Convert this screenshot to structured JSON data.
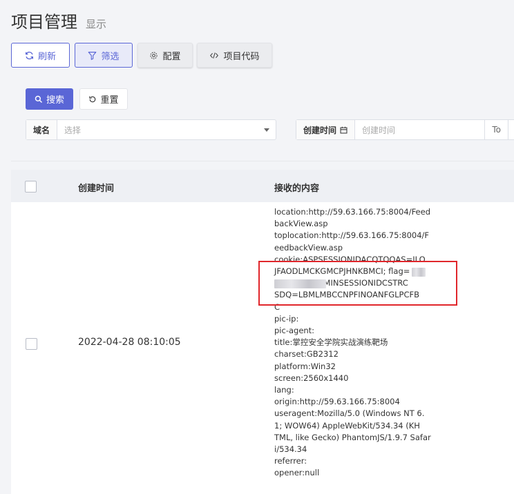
{
  "header": {
    "title": "项目管理",
    "subtitle": "显示"
  },
  "toolbar": {
    "refresh_label": "刷新",
    "filter_label": "筛选",
    "config_label": "配置",
    "code_label": "项目代码"
  },
  "search": {
    "search_label": "搜索",
    "reset_label": "重置",
    "domain_label": "域名",
    "domain_placeholder": "选择",
    "created_label": "创建时间",
    "created_placeholder": "创建时间",
    "to_label": "To"
  },
  "table": {
    "columns": [
      "创建时间",
      "接收的内容"
    ],
    "rows": [
      {
        "created": "2022-04-28 08:10:05",
        "content_lines": [
          "location:http://59.63.166.75:8004/Feed",
          "backView.asp",
          "toplocation:http://59.63.166.75:8004/F",
          "eedbackView.asp",
          "cookie:ASPSESSIONIDACQTQQAS=ILO",
          "JFAODLMCKGMCPJHNKBMCI; flag=",
          "               ADMINSESSIONIDCSTRC",
          "SDQ=LBMLMBCCNPFINOANFGLPCFB",
          "C",
          "pic-ip:",
          "pic-agent:",
          "title:掌控安全学院实战演练靶场",
          "charset:GB2312",
          "platform:Win32",
          "screen:2560x1440",
          "lang:",
          "origin:http://59.63.166.75:8004",
          "useragent:Mozilla/5.0 (Windows NT 6.",
          "1; WOW64) AppleWebKit/534.34 (KH",
          "TML, like Gecko) PhantomJS/1.9.7 Safar",
          "i/534.34",
          "referrer:",
          "opener:null"
        ]
      }
    ]
  },
  "colors": {
    "accent": "#5a66d6",
    "highlight": "#e0262b"
  }
}
